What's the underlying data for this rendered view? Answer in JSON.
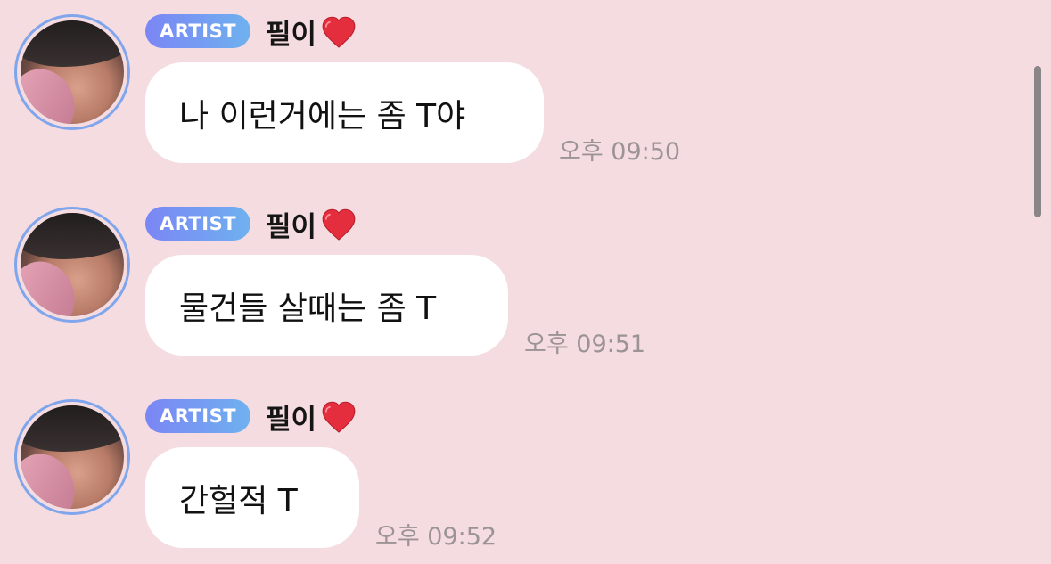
{
  "chat": {
    "messages": [
      {
        "badge": "ARTIST",
        "sender": "필이",
        "sender_emoji": "red-heart-icon",
        "text": "나 이런거에는 좀 T야",
        "time": "오후 09:50"
      },
      {
        "badge": "ARTIST",
        "sender": "필이",
        "sender_emoji": "red-heart-icon",
        "text": "물건들 살때는 좀 T",
        "time": "오후 09:51"
      },
      {
        "badge": "ARTIST",
        "sender": "필이",
        "sender_emoji": "red-heart-icon",
        "text": "간헐적 T",
        "time": "오후 09:52"
      }
    ]
  },
  "colors": {
    "background": "#f5dce1",
    "bubble": "#ffffff",
    "badge_gradient_start": "#7b86f5",
    "badge_gradient_end": "#6fb1ef",
    "avatar_ring": "#7fa6ec",
    "heart": "#e52e3d",
    "timestamp": "#9b9394"
  }
}
